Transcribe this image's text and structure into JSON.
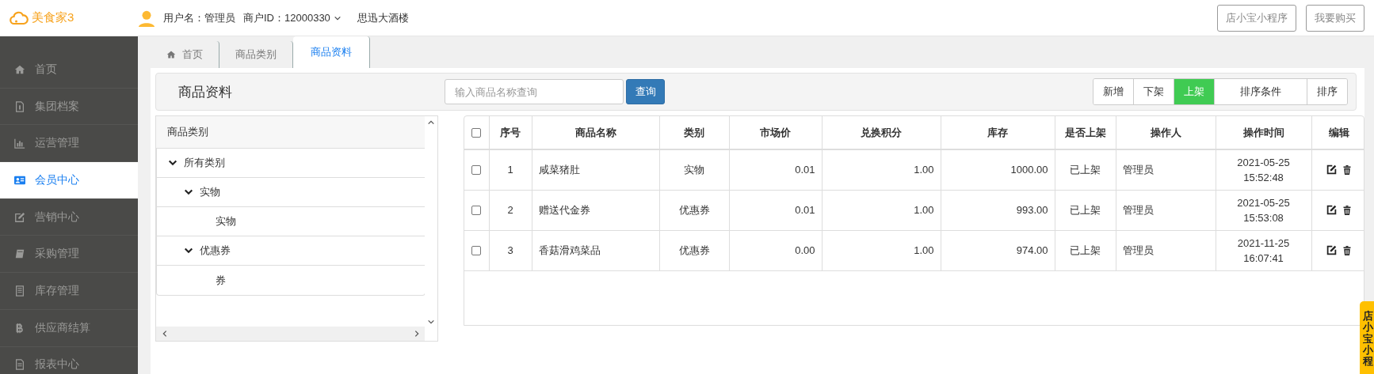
{
  "header": {
    "logo": "美食家3",
    "user": "用户名：管理员",
    "merchant": "商户ID：12000330",
    "store": "思迅大酒楼",
    "buttons": [
      "店小宝小程序",
      "我要购买"
    ]
  },
  "sidebar": {
    "items": [
      {
        "label": "首页",
        "selected": false
      },
      {
        "label": "集团档案",
        "selected": false
      },
      {
        "label": "运营管理",
        "selected": false
      },
      {
        "label": "会员中心",
        "selected": true
      },
      {
        "label": "营销中心",
        "selected": false
      },
      {
        "label": "采购管理",
        "selected": false
      },
      {
        "label": "库存管理",
        "selected": false
      },
      {
        "label": "供应商结算",
        "selected": false
      },
      {
        "label": "报表中心",
        "selected": false
      }
    ]
  },
  "tabs": [
    {
      "label": "首页",
      "selected": false
    },
    {
      "label": "商品类别",
      "selected": false
    },
    {
      "label": "商品资料",
      "selected": true
    }
  ],
  "toolbar": {
    "title": "商品资料",
    "search": {
      "placeholder": "输入商品名称查询"
    },
    "search_button": "查询",
    "actions": [
      {
        "label": "新增",
        "selected": false
      },
      {
        "label": "下架",
        "selected": false
      },
      {
        "label": "上架",
        "selected": true
      },
      {
        "label": "排序条件",
        "selected": false
      },
      {
        "label": "排序",
        "selected": false
      }
    ]
  },
  "category_tree": {
    "title": "商品类别",
    "nodes": [
      {
        "label": "所有类别",
        "expanded": true,
        "children": [
          {
            "label": "实物",
            "expanded": true,
            "children": [
              {
                "label": "实物"
              }
            ]
          },
          {
            "label": "优惠券",
            "expanded": true,
            "children": [
              {
                "label": "券"
              }
            ]
          }
        ]
      }
    ]
  },
  "table": {
    "header_checked": false,
    "columns": [
      "序号",
      "商品名称",
      "类别",
      "市场价",
      "兑换积分",
      "库存",
      "是否上架",
      "操作人",
      "操作时间",
      "编辑"
    ],
    "rows": [
      {
        "checked": false,
        "cells": [
          "1",
          "咸菜猪肚",
          "实物",
          "0.01",
          "1.00",
          "1000.00",
          "已上架",
          "管理员",
          "2021-05-25 15:52:48"
        ]
      },
      {
        "checked": false,
        "cells": [
          "2",
          "赠送代金券",
          "优惠券",
          "0.01",
          "1.00",
          "993.00",
          "已上架",
          "管理员",
          "2021-05-25 15:53:08"
        ]
      },
      {
        "checked": false,
        "cells": [
          "3",
          "香菇滑鸡菜品",
          "优惠券",
          "0.00",
          "1.00",
          "974.00",
          "已上架",
          "管理员",
          "2021-11-25 16:07:41"
        ]
      }
    ]
  },
  "side_tab": {
    "label": "店小宝小程"
  }
}
